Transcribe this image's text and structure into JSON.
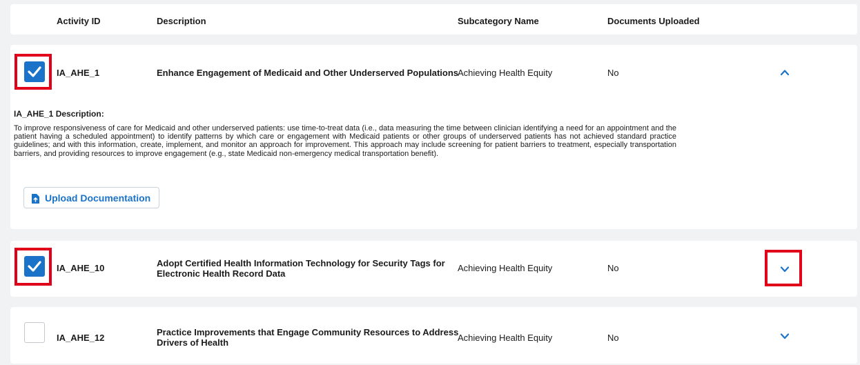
{
  "table_header": {
    "activity_id": "Activity ID",
    "description": "Description",
    "subcategory_name": "Subcategory Name",
    "documents_uploaded": "Documents Uploaded"
  },
  "rows": [
    {
      "id": "IA_AHE_1",
      "title": "Enhance Engagement of Medicaid and Other Underserved Populations",
      "subcategory": "Achieving Health Equity",
      "documents": "No",
      "checked": true,
      "expanded": true,
      "expand_icon": "chevron-up-icon",
      "desc_title": "IA_AHE_1 Description:",
      "desc_text": "To improve responsiveness of care for Medicaid and other underserved patients: use time-to-treat data (i.e., data measuring the time between clinician identifying a need for an appointment and the patient having a scheduled appointment) to identify patterns by which care or engagement with Medicaid patients or other groups of underserved patients has not achieved standard practice guidelines; and with this information, create, implement, and monitor an approach for improvement. This approach may include screening for patient barriers to treatment, especially transportation barriers, and providing resources to improve engagement (e.g., state Medicaid non-emergency medical transportation benefit).",
      "upload_label": "Upload Documentation"
    },
    {
      "id": "IA_AHE_10",
      "title_line1": "Adopt Certified Health Information Technology for Security Tags for",
      "title_line2": "Electronic Health Record Data",
      "subcategory": "Achieving Health Equity",
      "documents": "No",
      "checked": true,
      "expanded": false,
      "expand_icon": "chevron-down-icon"
    },
    {
      "id": "IA_AHE_12",
      "title_line1": "Practice Improvements that Engage Community Resources to Address",
      "title_line2": "Drivers of Health",
      "subcategory": "Achieving Health Equity",
      "documents": "No",
      "checked": false,
      "expanded": false,
      "expand_icon": "chevron-down-icon"
    }
  ],
  "colors": {
    "accent": "#1a73c8",
    "highlight": "#e0001a",
    "background": "#f1f2f4"
  }
}
